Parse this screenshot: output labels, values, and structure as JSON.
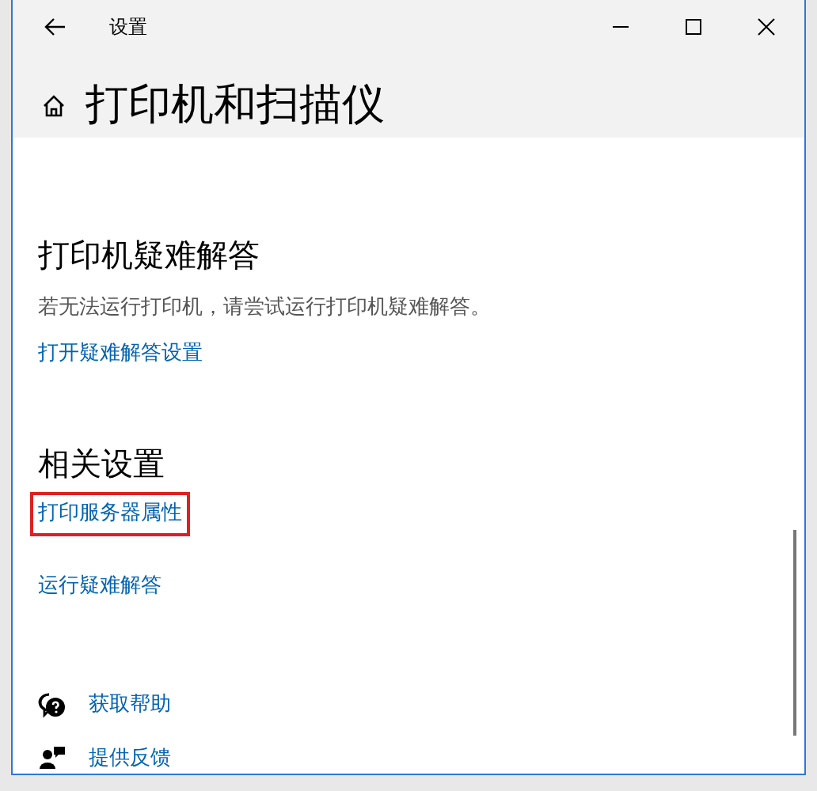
{
  "window": {
    "title": "设置"
  },
  "page_title": "打印机和扫描仪",
  "troubleshoot": {
    "heading": "打印机疑难解答",
    "description": "若无法运行打印机，请尝试运行打印机疑难解答。",
    "link": "打开疑难解答设置"
  },
  "related": {
    "heading": "相关设置",
    "links": [
      {
        "label": "打印服务器属性",
        "highlighted": true
      },
      {
        "label": "运行疑难解答",
        "highlighted": false
      }
    ]
  },
  "footer_links": [
    {
      "label": "获取帮助",
      "kind": "help"
    },
    {
      "label": "提供反馈",
      "kind": "feedback"
    }
  ]
}
